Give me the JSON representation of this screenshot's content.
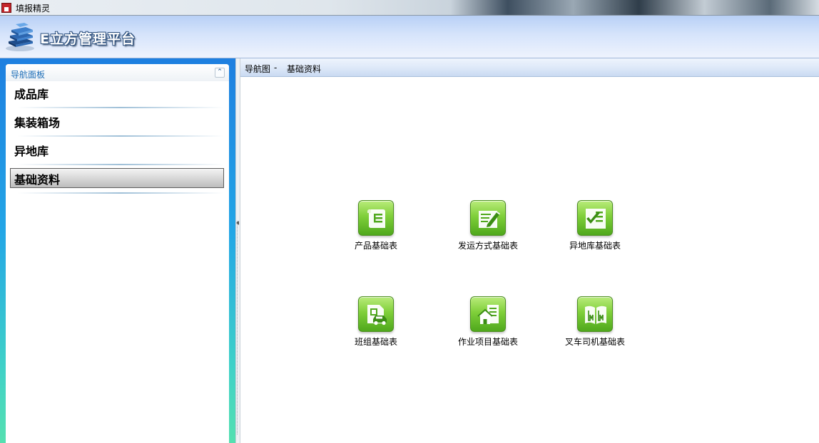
{
  "window": {
    "title": "填报精灵"
  },
  "banner": {
    "brand": "E立方管理平台"
  },
  "nav": {
    "header": "导航面板",
    "items": [
      {
        "label": "成品库",
        "selected": false
      },
      {
        "label": "集装箱场",
        "selected": false
      },
      {
        "label": "异地库",
        "selected": false
      },
      {
        "label": "基础资料",
        "selected": true
      }
    ]
  },
  "breadcrumb": {
    "root": "导航图",
    "separator": "-",
    "current": "基础资料"
  },
  "tiles": [
    {
      "label": "产品基础表",
      "icon": "document-list-icon"
    },
    {
      "label": "发运方式基础表",
      "icon": "pencil-edit-icon"
    },
    {
      "label": "异地库基础表",
      "icon": "checklist-icon"
    },
    {
      "label": "班组基础表",
      "icon": "car-document-icon"
    },
    {
      "label": "作业项目基础表",
      "icon": "house-icon"
    },
    {
      "label": "叉车司机基础表",
      "icon": "open-book-icon"
    }
  ],
  "colors": {
    "tile_green": "#7fcf3a",
    "nav_frame_blue": "#1e7fe0",
    "nav_header_text": "#1f6fb8"
  }
}
